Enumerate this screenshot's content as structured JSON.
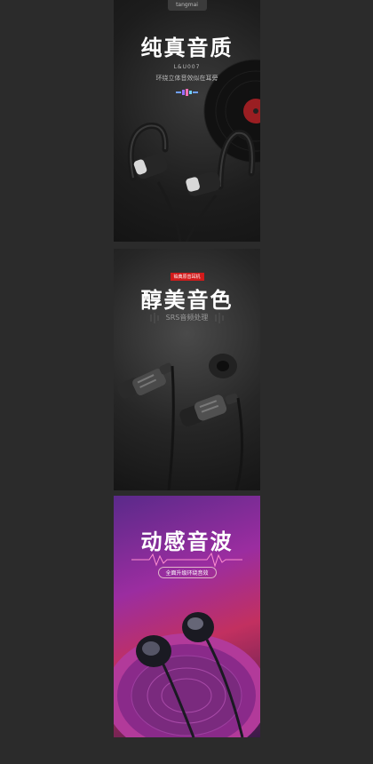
{
  "panel1": {
    "brand": "tangmai",
    "title": "纯真音质",
    "model": "L&U007",
    "subtitle": "环绕立体音效似在耳旁"
  },
  "panel2": {
    "tag": "铂典原音耳机",
    "title": "醇美音色",
    "subtitle": "SRS音频处理"
  },
  "panel3": {
    "title": "动感音波",
    "subtitle": "全面升级环绕音效"
  }
}
